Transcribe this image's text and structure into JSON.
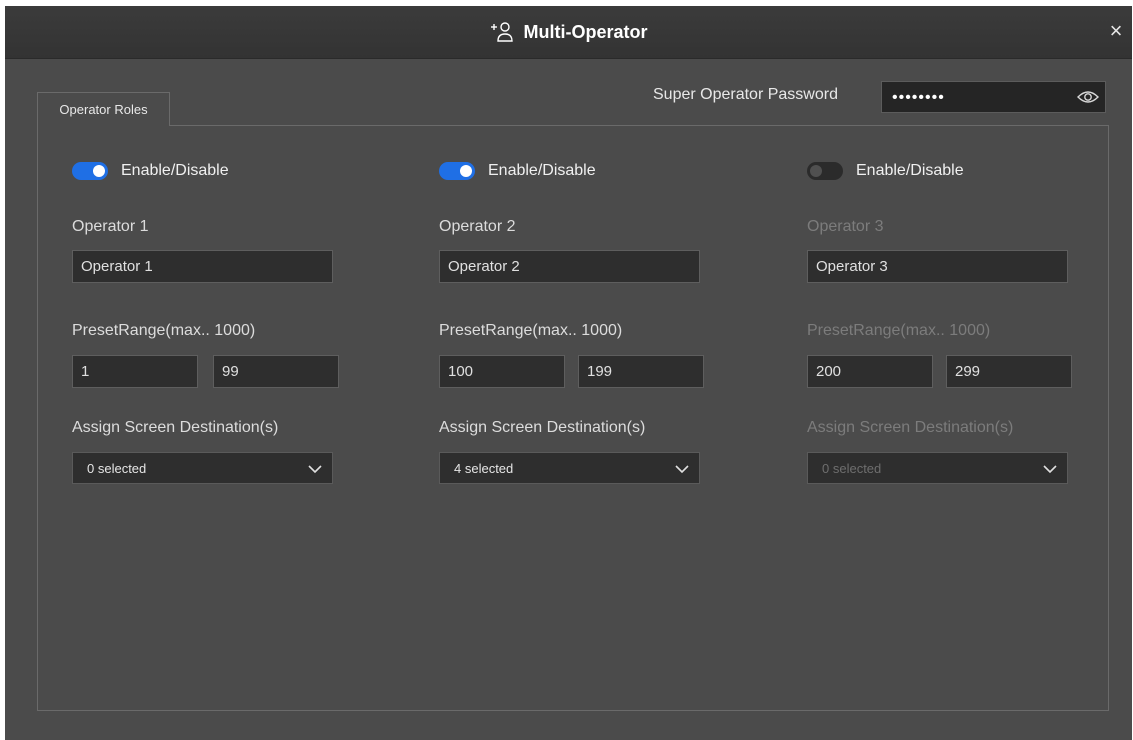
{
  "window": {
    "title": "Multi-Operator",
    "title_icon": "add-user-icon",
    "close_icon": "close-icon",
    "close_glyph": "×"
  },
  "password": {
    "label": "Super Operator Password",
    "value": "••••••••",
    "visibility_icon": "eye-icon"
  },
  "tabs": [
    {
      "label": "Operator Roles",
      "active": true
    }
  ],
  "colors": {
    "accent": "#1f6fe5",
    "background": "#4b4b4b",
    "titlebar": "#363636"
  },
  "operators": [
    {
      "enabled": true,
      "toggle_label": "Enable/Disable",
      "heading": "Operator 1",
      "name_value": "Operator 1",
      "preset_label": "PresetRange(max.. 1000)",
      "preset_min": "1",
      "preset_max": "99",
      "screen_label": "Assign Screen Destination(s)",
      "screen_selected": "0 selected"
    },
    {
      "enabled": true,
      "toggle_label": "Enable/Disable",
      "heading": "Operator 2",
      "name_value": "Operator 2",
      "preset_label": "PresetRange(max.. 1000)",
      "preset_min": "100",
      "preset_max": "199",
      "screen_label": "Assign Screen Destination(s)",
      "screen_selected": "4 selected"
    },
    {
      "enabled": false,
      "toggle_label": "Enable/Disable",
      "heading": "Operator 3",
      "name_value": "Operator 3",
      "preset_label": "PresetRange(max.. 1000)",
      "preset_min": "200",
      "preset_max": "299",
      "screen_label": "Assign Screen Destination(s)",
      "screen_selected": "0 selected"
    }
  ]
}
